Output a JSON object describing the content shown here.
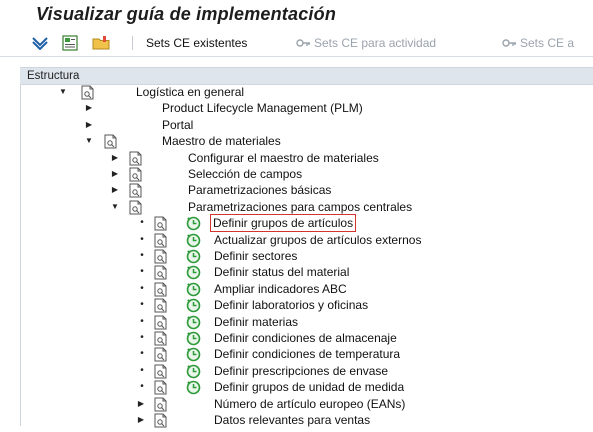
{
  "window": {
    "title": "Visualizar guía de implementación"
  },
  "toolbar": {
    "btn_sets_ce_existentes": "Sets CE existentes",
    "btn_sets_ce_actividad": "Sets CE para actividad",
    "btn_sets_ce_cut": "Sets CE a"
  },
  "tree": {
    "header": "Estructura",
    "root": "Logística en general",
    "level1": [
      "Product Lifecycle Management (PLM)",
      "Portal",
      "Maestro de materiales"
    ],
    "level2": [
      "Configurar el maestro de materiales",
      "Selección de campos",
      "Parametrizaciones básicas",
      "Parametrizaciones para campos centrales"
    ],
    "activities": [
      "Definir grupos de artículos",
      "Actualizar grupos de artículos externos",
      "Definir sectores",
      "Definir status del material",
      "Ampliar indicadores ABC",
      "Definir laboratorios y oficinas",
      "Definir materias",
      "Definir condiciones de almacenaje",
      "Definir condiciones de temperatura",
      "Definir prescripciones de envase",
      "Definir grupos de unidad de medida"
    ],
    "extra_nodes": [
      "Número de artículo europeo (EANs)",
      "Datos relevantes para ventas"
    ]
  },
  "colors": {
    "highlight_border": "#d3342b",
    "header_bg": "#dfe5ec",
    "clock_green": "#2e9a3a"
  }
}
